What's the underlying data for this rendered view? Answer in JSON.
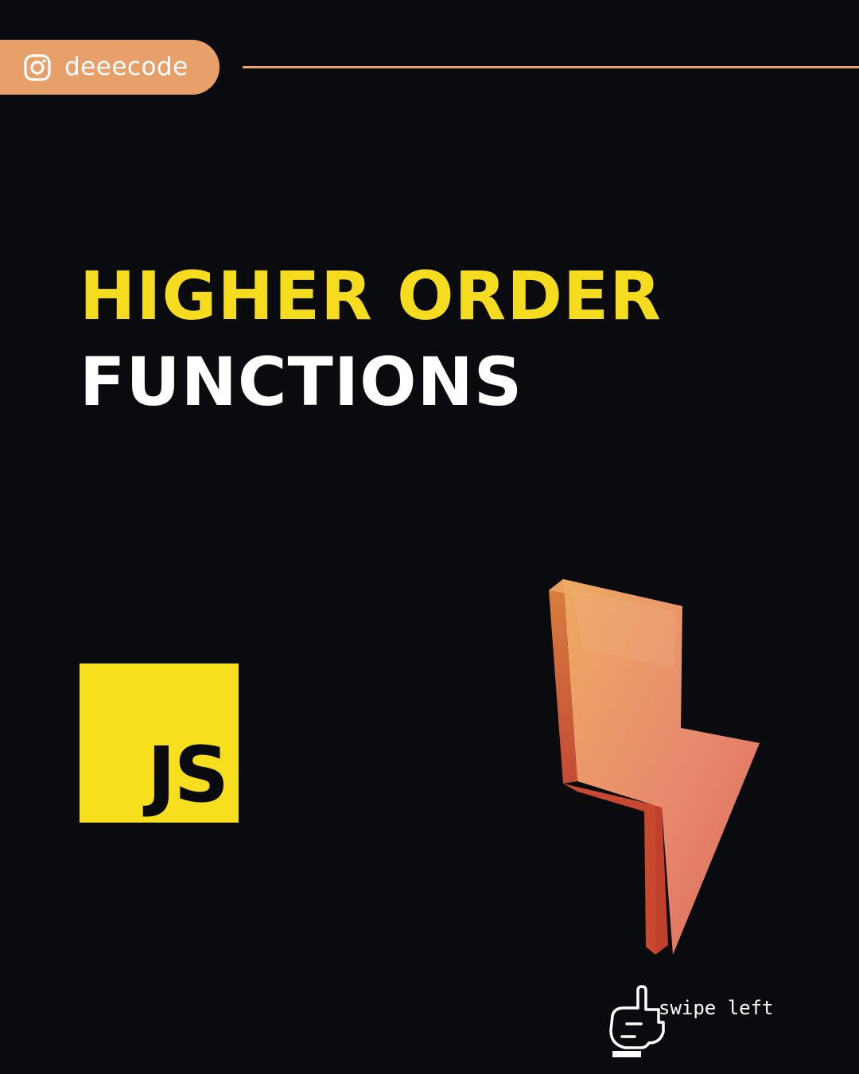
{
  "header": {
    "handle": "deeecode",
    "social_icon": "instagram-icon",
    "accent_color": "#e8a06b"
  },
  "title": {
    "line1": "HIGHER ORDER",
    "line2": "FUNCTIONS",
    "line1_color": "#f5dc1e",
    "line2_color": "#ffffff"
  },
  "logo": {
    "text": "JS",
    "background": "#f7df1e"
  },
  "decoration": {
    "icon": "lightning-bolt-icon"
  },
  "footer": {
    "hint": "swipe left",
    "icon": "swipe-hand-icon"
  }
}
